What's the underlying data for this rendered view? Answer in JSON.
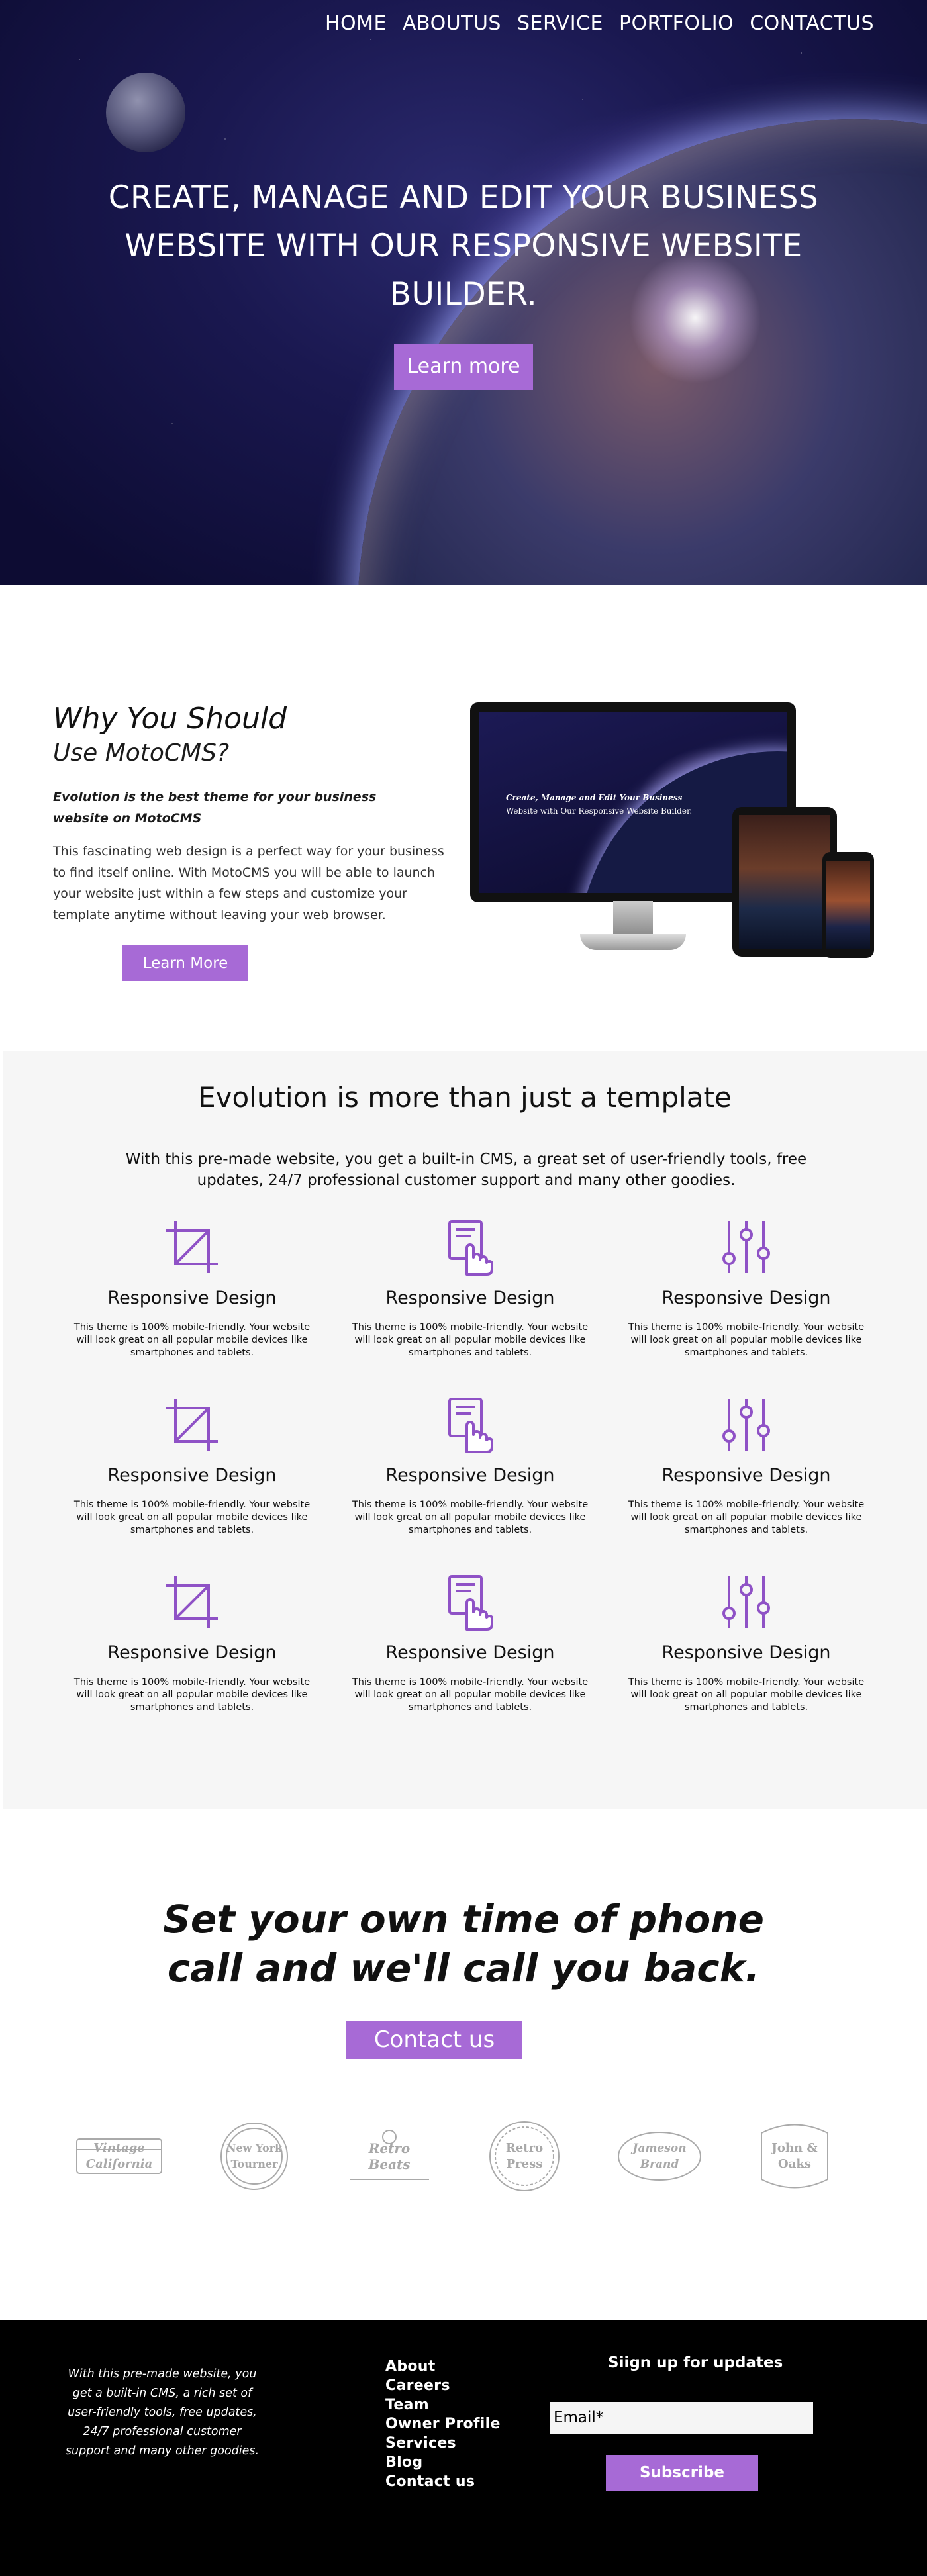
{
  "nav": {
    "items": [
      "HOME",
      "ABOUTUS",
      "SERVICE",
      "PORTFOLIO",
      "CONTACTUS"
    ]
  },
  "hero": {
    "title": "CREATE, MANAGE AND EDIT YOUR BUSINESS WEBSITE WITH OUR RESPONSIVE WEBSITE BUILDER.",
    "button": "Learn more"
  },
  "why": {
    "title": "Why You Should",
    "subtitle": "Use MotoCMS?",
    "lead": "Evolution is the best theme for your business website on MotoCMS",
    "body": "This fascinating web design is a perfect way for your business to find itself online. With MotoCMS you will be able to launch your website just within a few steps and customize your template anytime without leaving your web browser.",
    "button": "Learn More",
    "screen_text_1": "Create, Manage and Edit Your Business",
    "screen_text_2": "Website with Our Responsive Website Builder."
  },
  "evolution": {
    "title": "Evolution is more than just a template",
    "subtitle": "With this pre-made website, you get a built-in CMS, a great set of user-friendly tools, free updates, 24/7 professional customer support and many other goodies.",
    "features": [
      {
        "icon": "crop-icon",
        "title": "Responsive Design",
        "text": "This theme is 100% mobile-friendly. Your website will look great on all popular mobile devices like smartphones and tablets."
      },
      {
        "icon": "touch-document-icon",
        "title": "Responsive Design",
        "text": "This theme is 100% mobile-friendly. Your website will look great on all popular mobile devices like smartphones and tablets."
      },
      {
        "icon": "sliders-icon",
        "title": "Responsive Design",
        "text": "This theme is 100% mobile-friendly. Your website will look great on all popular mobile devices like smartphones and tablets."
      },
      {
        "icon": "crop-icon",
        "title": "Responsive Design",
        "text": "This theme is 100% mobile-friendly. Your website will look great on all popular mobile devices like smartphones and tablets."
      },
      {
        "icon": "touch-document-icon",
        "title": "Responsive Design",
        "text": "This theme is 100% mobile-friendly. Your website will look great on all popular mobile devices like smartphones and tablets."
      },
      {
        "icon": "sliders-icon",
        "title": "Responsive Design",
        "text": "This theme is 100% mobile-friendly. Your website will look great on all popular mobile devices like smartphones and tablets."
      },
      {
        "icon": "crop-icon",
        "title": "Responsive Design",
        "text": "This theme is 100% mobile-friendly. Your website will look great on all popular mobile devices like smartphones and tablets."
      },
      {
        "icon": "touch-document-icon",
        "title": "Responsive Design",
        "text": "This theme is 100% mobile-friendly. Your website will look great on all popular mobile devices like smartphones and tablets."
      },
      {
        "icon": "sliders-icon",
        "title": "Responsive Design",
        "text": "This theme is 100% mobile-friendly. Your website will look great on all popular mobile devices like smartphones and tablets."
      }
    ]
  },
  "callback": {
    "title_line1": "Set your own time of phone",
    "title_line2": "call and we'll call you back.",
    "button": "Contact us",
    "logos": [
      "Vintage California",
      "New York Tourner",
      "Retro Beats",
      "Retro Press",
      "Jameson Brand",
      "John & Oaks"
    ]
  },
  "footer": {
    "about": "With this pre-made website, you get a built-in CMS, a rich set of user-friendly tools, free updates, 24/7 professional customer support and many other goodies.",
    "links": [
      "About",
      "Careers",
      "Team",
      "Owner Profile",
      "Services",
      "Blog",
      "Contact us"
    ],
    "signup_title": "Siign up for updates",
    "email_placeholder": "Email*",
    "subscribe": "Subscribe"
  },
  "colors": {
    "accent": "#a76ad6",
    "icon": "#8f52c6",
    "footer_bg": "#000000",
    "section_bg": "#f6f6f6"
  }
}
